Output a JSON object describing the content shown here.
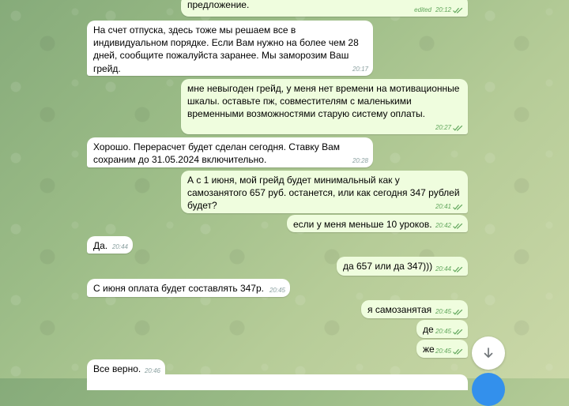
{
  "messages": [
    {
      "dir": "out",
      "text": "предложение.",
      "edited": "edited",
      "time": "20:12",
      "checks": true
    },
    {
      "dir": "in",
      "text": "На счет отпуска, здесь тоже мы решаем все в индивидуальном порядке. Если Вам нужно на более чем 28 дней, сообщите пожалуйста заранее. Мы заморозим Ваш грейд.",
      "time": "20:17"
    },
    {
      "dir": "out",
      "text": "мне невыгоден грейд, у меня нет времени на мотивационные шкалы. оставьте пж, совместителям с маленькими временными возможностями старую систему оплаты.",
      "time": "20:27",
      "checks": true
    },
    {
      "dir": "in",
      "text": "Хорошо. Перерасчет будет сделан сегодня. Ставку Вам сохраним до 31.05.2024 включительно.",
      "time": "20:28"
    },
    {
      "dir": "out",
      "text": "А с 1 июня, мой грейд будет минимальный как у самозанятого 657 руб. останется, или как сегодня 347 рублей будет?",
      "time": "20:41",
      "checks": true
    },
    {
      "dir": "out",
      "text": "если у меня меньше 10 уроков.",
      "time": "20:42",
      "checks": true
    },
    {
      "dir": "in",
      "text": "Да.",
      "time": "20:44"
    },
    {
      "dir": "out",
      "text": "да 657 или да 347)))",
      "time": "20:44",
      "checks": true
    },
    {
      "dir": "in",
      "text": "С июня оплата будет составлять 347р.",
      "time": "20:45"
    },
    {
      "dir": "out",
      "text": "я самозанятая",
      "time": "20:45",
      "checks": true
    },
    {
      "dir": "out",
      "text": "де",
      "time": "20:45",
      "checks": true
    },
    {
      "dir": "out",
      "text": "же",
      "time": "20:45",
      "checks": true
    },
    {
      "dir": "in",
      "text": "Все верно.",
      "time": "20:46"
    }
  ],
  "icons": {
    "scroll_down": "arrow-down-icon",
    "read_status": "double-check-icon"
  },
  "colors": {
    "incoming": "#ffffff",
    "outgoing": "#effdde",
    "check": "#5fa55a",
    "accent": "#3390ec"
  }
}
